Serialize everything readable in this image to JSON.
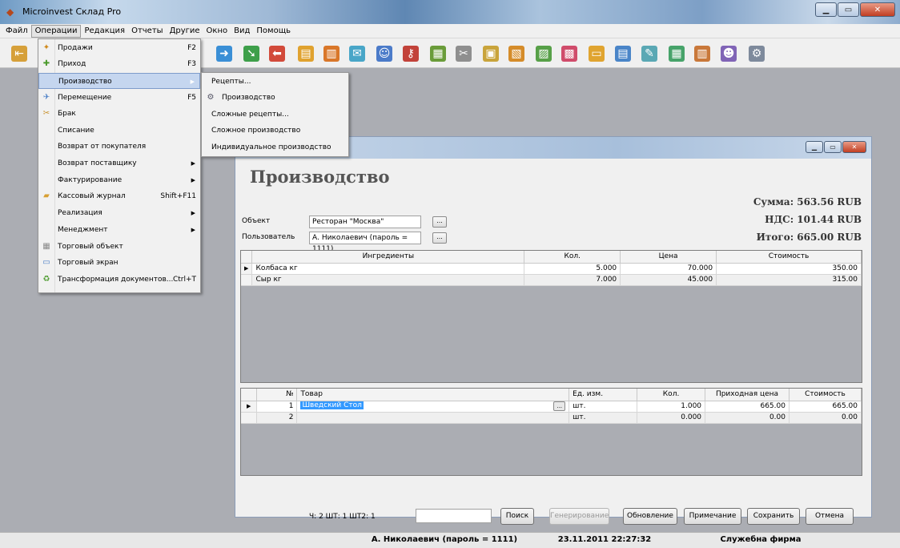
{
  "app": {
    "title": "Microinvest Склад Pro"
  },
  "menubar": [
    "Файл",
    "Операции",
    "Редакция",
    "Отчеты",
    "Другие",
    "Окно",
    "Вид",
    "Помощь"
  ],
  "operations_menu": [
    {
      "label": "Продажи",
      "shortcut": "F2",
      "icon": "sales-icon"
    },
    {
      "label": "Приход",
      "shortcut": "F3",
      "icon": "purchase-icon"
    },
    {
      "label": "Производство",
      "shortcut": "",
      "submenu": true
    },
    {
      "label": "Перемещение",
      "shortcut": "F5",
      "icon": "transfer-icon"
    },
    {
      "label": "Брак",
      "shortcut": "",
      "icon": "waste-icon"
    },
    {
      "label": "Списание",
      "shortcut": ""
    },
    {
      "label": "Возврат от покупателя",
      "shortcut": ""
    },
    {
      "label": "Возврат поставщику",
      "shortcut": "",
      "submenu": true
    },
    {
      "label": "Фактурирование",
      "shortcut": "",
      "submenu": true
    },
    {
      "label": "Кассовый журнал",
      "shortcut": "Shift+F11",
      "icon": "cash-journal-icon"
    },
    {
      "label": "Реализация",
      "shortcut": "",
      "submenu": true
    },
    {
      "label": "Менеджмент",
      "shortcut": "",
      "submenu": true
    },
    {
      "label": "Торговый объект",
      "shortcut": "",
      "icon": "trade-object-icon"
    },
    {
      "label": "Торговый экран",
      "shortcut": "",
      "icon": "trade-screen-icon"
    },
    {
      "label": "Трансформация документов...",
      "shortcut": "Ctrl+T",
      "icon": "transform-icon"
    }
  ],
  "production_submenu": [
    "Рецепты...",
    "Производство",
    "Сложные рецепты...",
    "Сложное производство",
    "Индивидуальное производство"
  ],
  "document": {
    "title": "Производство",
    "object_label": "Объект",
    "object_value": "Ресторан \"Москва\"",
    "user_label": "Пользователь",
    "user_value": "А. Николаевич (пароль = 1111)",
    "sum": "Сумма: 563.56 RUB",
    "vat": "НДС: 101.44 RUB",
    "total": "Итого: 665.00 RUB"
  },
  "ingredients": {
    "headers": [
      "Ингредиенты",
      "Кол.",
      "Цена",
      "Стоимость"
    ],
    "rows": [
      {
        "name": "Колбаса кг",
        "qty": "5.000",
        "price": "70.000",
        "cost": "350.00"
      },
      {
        "name": "Сыр кг",
        "qty": "7.000",
        "price": "45.000",
        "cost": "315.00"
      }
    ]
  },
  "products": {
    "headers": [
      "№",
      "Товар",
      "Ед. изм.",
      "Кол.",
      "Приходная цена",
      "Стоимость"
    ],
    "rows": [
      {
        "no": "1",
        "name": "Шведский Стол",
        "unit": "шт.",
        "qty": "1.000",
        "price": "665.00",
        "cost": "665.00"
      },
      {
        "no": "2",
        "name": "",
        "unit": "шт.",
        "qty": "0.000",
        "price": "0.00",
        "cost": "0.00"
      }
    ]
  },
  "bottom": {
    "counts": "Ч: 2  ШТ: 1  ШТ2: 1",
    "search": "Поиск",
    "generate": "Генерирование",
    "refresh": "Обновление",
    "note": "Примечание",
    "save": "Сохранить",
    "cancel": "Отмена"
  },
  "status": {
    "user": "А. Николаевич (пароль = 1111)",
    "datetime": "23.11.2011 22:27:32",
    "company": "Служебна фирма"
  }
}
